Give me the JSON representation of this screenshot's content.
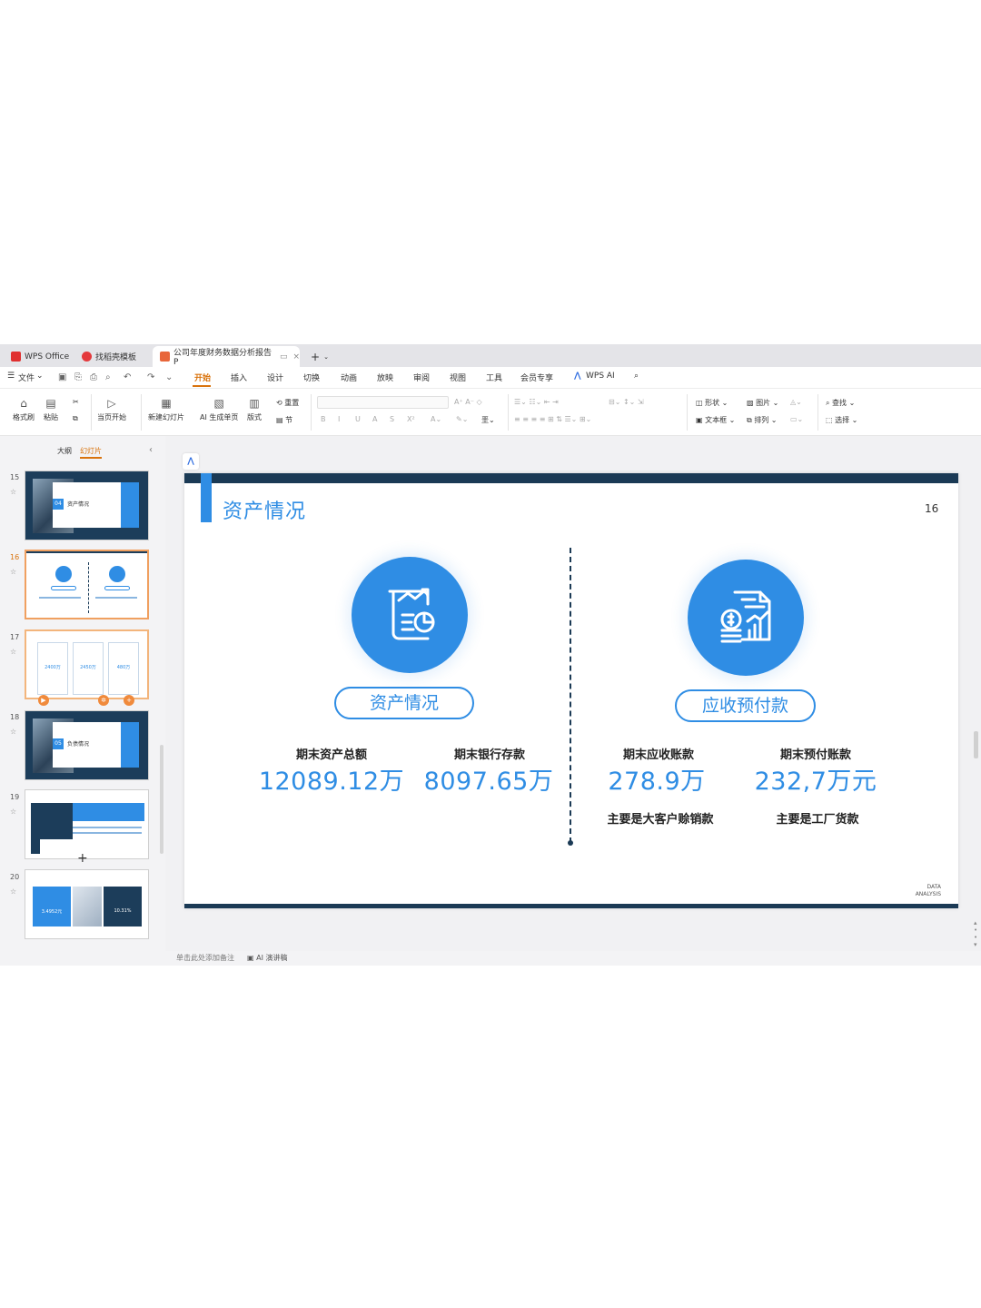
{
  "tabs": [
    {
      "label": "WPS Office"
    },
    {
      "label": "找稻壳模板"
    },
    {
      "label": "公司年度财务数据分析报告P"
    }
  ],
  "menu": {
    "file": "文件",
    "items": [
      "开始",
      "插入",
      "设计",
      "切换",
      "动画",
      "放映",
      "审阅",
      "视图",
      "工具",
      "会员专享"
    ],
    "wps_ai": "WPS AI"
  },
  "ribbon": {
    "format_painter": "格式刷",
    "paste": "粘贴",
    "from_current": "当页开始",
    "new_slide": "新建幻灯片",
    "ai_generate": "AI 生成单页",
    "layout": "版式",
    "reset": "重置",
    "section": "节",
    "shape": "形状",
    "picture": "图片",
    "textbox": "文本框",
    "arrange": "排列",
    "find": "查找",
    "select": "选择"
  },
  "left_panel": {
    "tab_outline": "大纲",
    "tab_slides": "幻灯片",
    "thumbs": [
      {
        "num": "15",
        "section_no": "04",
        "section_label": "资产情况"
      },
      {
        "num": "16"
      },
      {
        "num": "17",
        "values": [
          "2400万",
          "2450万",
          "480万"
        ]
      },
      {
        "num": "18",
        "section_no": "05",
        "section_label": "负债情况"
      },
      {
        "num": "19"
      },
      {
        "num": "20",
        "values": [
          "3.4952元",
          "10.31%"
        ]
      }
    ]
  },
  "slide": {
    "title": "资产情况",
    "page_number": "16",
    "left": {
      "pill": "资产情况",
      "stats": [
        {
          "label": "期末资产总额",
          "value": "12089.12万"
        },
        {
          "label": "期末银行存款",
          "value": "8097.65万"
        }
      ]
    },
    "right": {
      "pill": "应收预付款",
      "stats": [
        {
          "label": "期末应收账款",
          "value": "278.9万",
          "note": "主要是大客户赊销款"
        },
        {
          "label": "期末预付账款",
          "value": "232,7万元",
          "note": "主要是工厂货款"
        }
      ]
    },
    "logo_line1": "DATA",
    "logo_line2": "ANALYSIS"
  },
  "status": {
    "notes_placeholder": "单击此处添加备注",
    "ai_speech": "AI 演讲稿"
  },
  "colors": {
    "accent_blue": "#2f8de4",
    "navy": "#1b3a55",
    "active_orange": "#d9730d"
  }
}
